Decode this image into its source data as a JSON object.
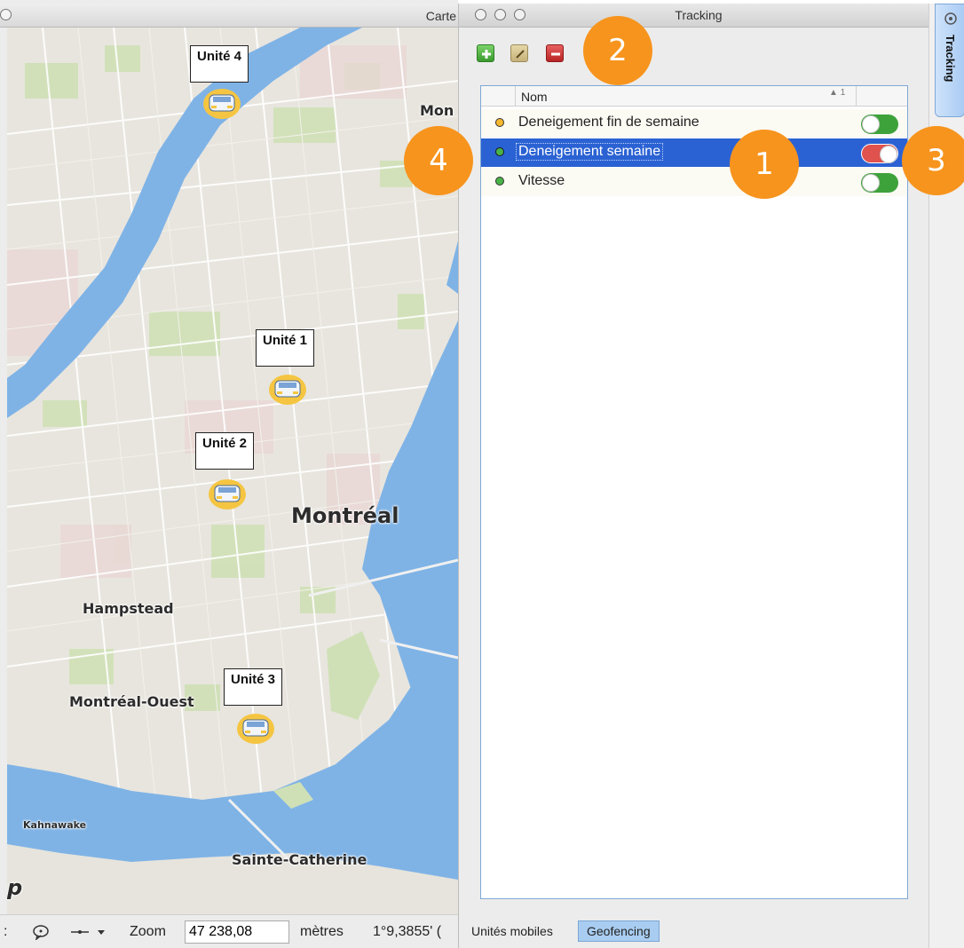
{
  "map_window": {
    "title": "Carte",
    "places": {
      "montreal": "Montréal",
      "mon_partial": "Mon",
      "hampstead": "Hampstead",
      "montreal_ouest": "Montréal-Ouest",
      "kahnawake": "Kahnawake",
      "sainte_catherine": "Sainte-Catherine",
      "logo_partial": "p"
    },
    "units": [
      "Unité 4",
      "Unité 1",
      "Unité 2",
      "Unité 3"
    ],
    "statusbar": {
      "left_glyph": ":",
      "zoom_label": "Zoom",
      "zoom_value": "47 238,08",
      "units_label": "mètres",
      "coordinate": "1°9,3855' ("
    }
  },
  "tracking_window": {
    "title": "Tracking",
    "toolbar": {
      "add_icon": "plus-icon",
      "edit_icon": "pencil-icon",
      "delete_icon": "minus-icon"
    },
    "table": {
      "column_header": "Nom",
      "sort_indicator": "1",
      "rows": [
        {
          "label": "Deneigement fin de semaine",
          "status_color": "#f5b82e",
          "enabled": true,
          "selected": false
        },
        {
          "label": "Deneigement semaine",
          "status_color": "#48b347",
          "enabled": false,
          "selected": true
        },
        {
          "label": "Vitesse",
          "status_color": "#48b347",
          "enabled": true,
          "selected": false
        }
      ]
    },
    "tabs": {
      "unites_mobiles": "Unités mobiles",
      "geofencing": "Geofencing"
    }
  },
  "dock": {
    "tab_label": "Tracking"
  },
  "callouts": {
    "c1": "1",
    "c2": "2",
    "c3": "3",
    "c4": "4"
  },
  "colors": {
    "callout": "#f7941d",
    "selection": "#2b62d3",
    "toggle_on": "#3ea23a",
    "toggle_off": "#e0524e",
    "water": "#7fb3e6"
  }
}
